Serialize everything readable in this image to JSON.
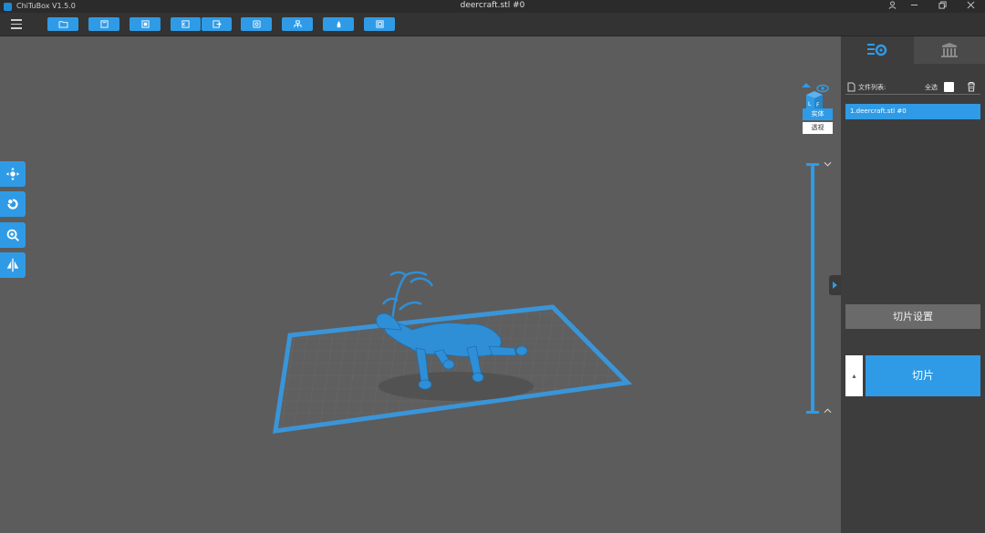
{
  "titlebar": {
    "app_title": "ChiTuBox V1.5.0",
    "window_title": "deercraft.stl #0"
  },
  "toolbar": {
    "buttons": [
      "open-file-icon",
      "save-icon",
      "import-icon",
      "undo-icon",
      "export-icon",
      "settings-icon",
      "support-icon",
      "hollow-icon",
      "snapshot-icon"
    ]
  },
  "view_mode": {
    "solid": "实体",
    "transparent": "透视"
  },
  "panel": {
    "file_list_label": "文件列表:",
    "select_all_label": "全选",
    "files": [
      "1.deercraft.stl #0"
    ],
    "slice_settings": "切片设置",
    "slice_button": "切片",
    "slice_expand": "▴"
  },
  "colors": {
    "accent": "#2f9be6",
    "background": "#5c5c5c",
    "panel": "#3d3d3d"
  }
}
